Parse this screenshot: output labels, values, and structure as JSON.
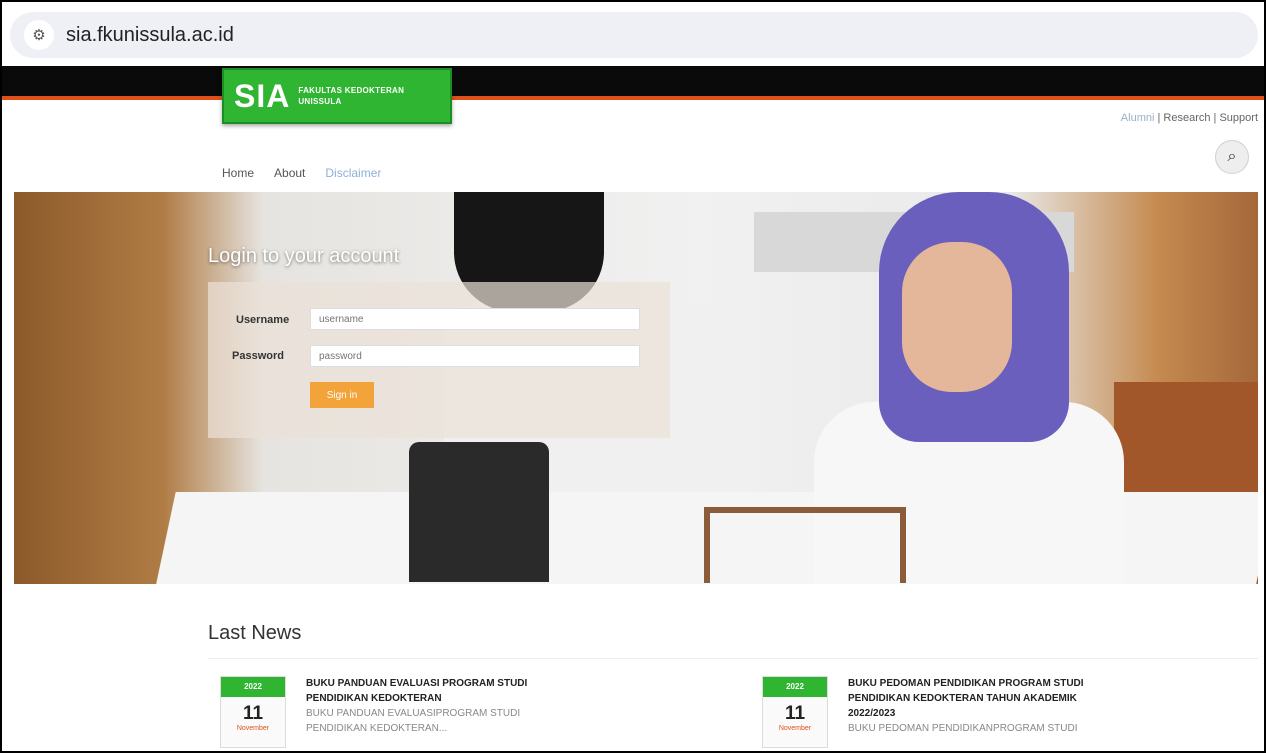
{
  "browser": {
    "url": "sia.fkunissula.ac.id"
  },
  "header": {
    "logo_main": "SIA",
    "logo_sub_line1": "FAKULTAS KEDOKTERAN",
    "logo_sub_line2": "UNISSULA",
    "toplinks": [
      "Alumni",
      "Research",
      "Support"
    ],
    "nav": [
      "Home",
      "About",
      "Disclaimer"
    ]
  },
  "login": {
    "title": "Login to your account",
    "username_label": "Username",
    "username_placeholder": "username",
    "password_label": "Password",
    "password_placeholder": "password",
    "signin_label": "Sign in"
  },
  "news": {
    "title": "Last News",
    "items": [
      {
        "year": "2022",
        "day": "11",
        "month": "November",
        "title_line1": "BUKU PANDUAN EVALUASI PROGRAM STUDI",
        "title_line2": "PENDIDIKAN KEDOKTERAN",
        "desc_line1": "BUKU PANDUAN EVALUASIPROGRAM STUDI",
        "desc_line2": "PENDIDIKAN KEDOKTERAN..."
      },
      {
        "year": "2022",
        "day": "11",
        "month": "November",
        "title_line1": "BUKU PEDOMAN PENDIDIKAN PROGRAM STUDI",
        "title_line2": "PENDIDIKAN KEDOKTERAN TAHUN AKADEMIK",
        "title_line3": "2022/2023",
        "desc_line1": "BUKU PEDOMAN PENDIDIKANPROGRAM STUDI"
      }
    ]
  },
  "colors": {
    "brand_green": "#2fb531",
    "accent_orange": "#f2a33a",
    "top_bar": "#0a0a0a",
    "header_stripe": "#e0501a"
  }
}
